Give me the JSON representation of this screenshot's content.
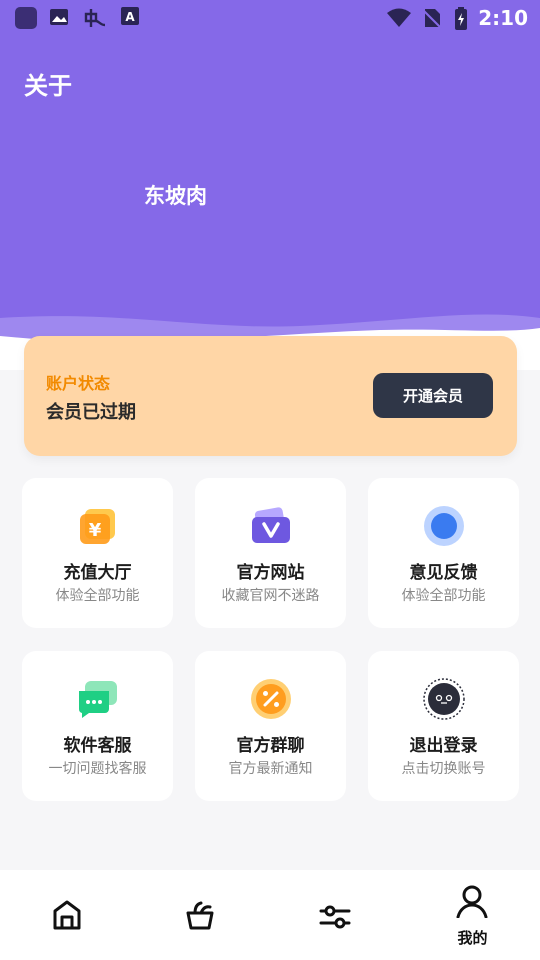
{
  "status_bar": {
    "time": "2:10",
    "left_icons": [
      "app-square-icon",
      "image-icon",
      "bug-icon",
      "font-icon"
    ],
    "right_icons": [
      "wifi-icon",
      "no-sim-icon",
      "battery-charging-icon"
    ]
  },
  "header": {
    "title": "关于",
    "nickname": "东坡肉",
    "color": "#8569e8"
  },
  "vip": {
    "label": "账户状态",
    "status": "会员已过期",
    "button": "开通会员"
  },
  "features": [
    {
      "title": "充值大厅",
      "subtitle": "体验全部功能",
      "icon": "recharge-coin-icon"
    },
    {
      "title": "官方网站",
      "subtitle": "收藏官网不迷路",
      "icon": "website-v-icon"
    },
    {
      "title": "意见反馈",
      "subtitle": "体验全部功能",
      "icon": "feedback-circle-icon"
    },
    {
      "title": "软件客服",
      "subtitle": "一切问题找客服",
      "icon": "chat-bubble-icon"
    },
    {
      "title": "官方群聊",
      "subtitle": "官方最新通知",
      "icon": "percent-badge-icon"
    },
    {
      "title": "退出登录",
      "subtitle": "点击切换账号",
      "icon": "logout-avatar-icon"
    }
  ],
  "tabs": [
    {
      "icon": "home-icon",
      "label": ""
    },
    {
      "icon": "basket-icon",
      "label": ""
    },
    {
      "icon": "sliders-icon",
      "label": ""
    },
    {
      "icon": "user-icon",
      "label": "我的"
    }
  ]
}
